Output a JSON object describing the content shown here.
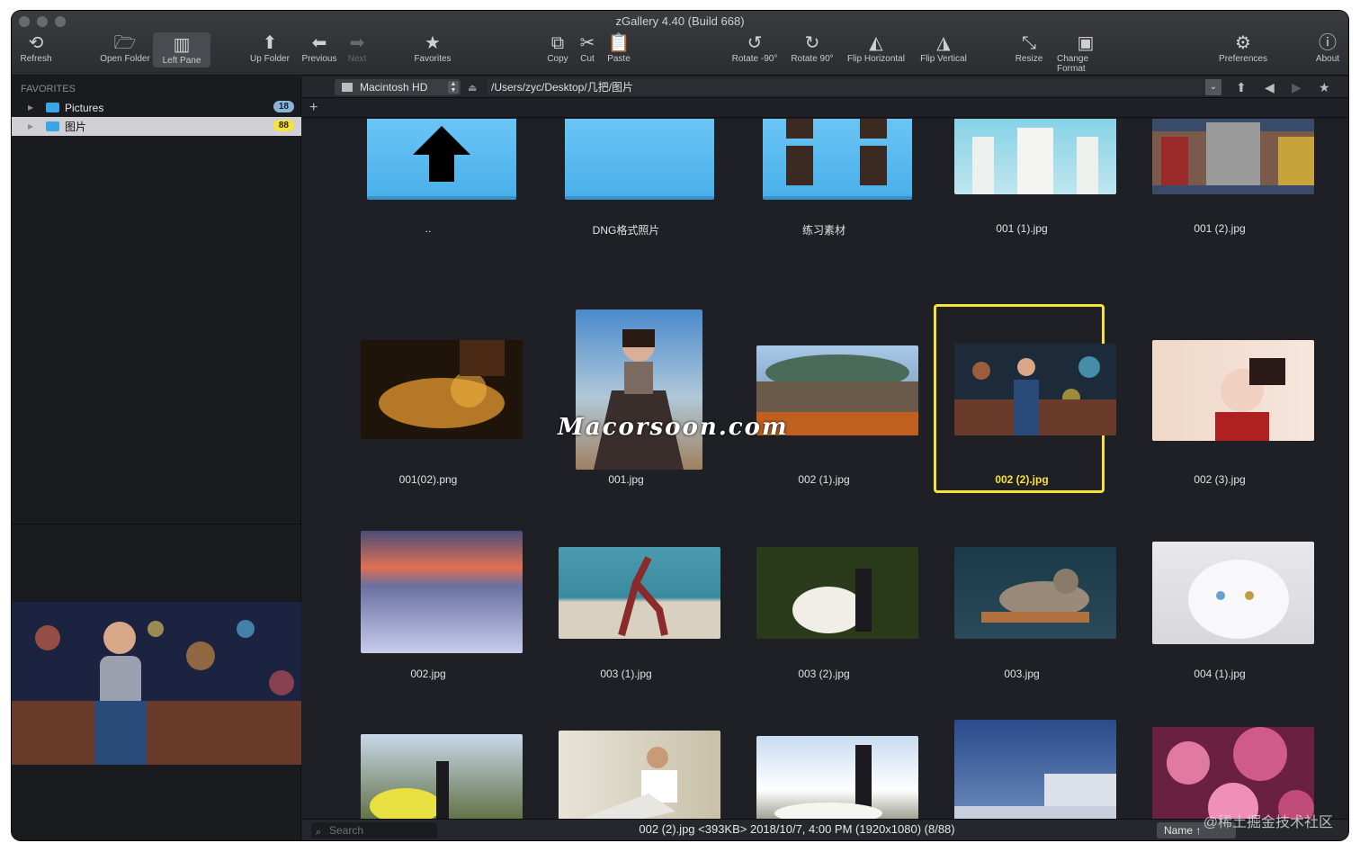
{
  "window": {
    "title": "zGallery 4.40 (Build 668)"
  },
  "toolbar": {
    "refresh": "Refresh",
    "open_folder": "Open Folder",
    "left_pane": "Left Pane",
    "up_folder": "Up Folder",
    "previous": "Previous",
    "next": "Next",
    "favorites": "Favorites",
    "copy": "Copy",
    "cut": "Cut",
    "paste": "Paste",
    "rotate_left": "Rotate -90°",
    "rotate_right": "Rotate 90°",
    "flip_h": "Flip Horizontal",
    "flip_v": "Flip Vertical",
    "resize": "Resize",
    "change_format": "Change Format",
    "preferences": "Preferences",
    "about": "About"
  },
  "sidebar": {
    "section": "FAVORITES",
    "items": [
      {
        "label": "Pictures",
        "count": "18"
      },
      {
        "label": "图片",
        "count": "88"
      }
    ]
  },
  "pathbar": {
    "volume": "Macintosh HD",
    "path": "/Users/zyc/Desktop/几把/图片"
  },
  "files": [
    {
      "name": ".."
    },
    {
      "name": "DNG格式照片"
    },
    {
      "name": "练习素材"
    },
    {
      "name": "001 (1).jpg"
    },
    {
      "name": "001 (2).jpg"
    },
    {
      "name": "001(02).png"
    },
    {
      "name": "001.jpg"
    },
    {
      "name": "002 (1).jpg"
    },
    {
      "name": "002 (2).jpg"
    },
    {
      "name": "002 (3).jpg"
    },
    {
      "name": "002.jpg"
    },
    {
      "name": "003 (1).jpg"
    },
    {
      "name": "003 (2).jpg"
    },
    {
      "name": "003.jpg"
    },
    {
      "name": "004 (1).jpg"
    }
  ],
  "status": {
    "search_placeholder": "Search",
    "info": "002 (2).jpg <393KB> 2018/10/7, 4:00 PM (1920x1080) (8/88)",
    "sort": "Name ↑"
  },
  "overlay": {
    "watermark": "Macorsoon.com",
    "corner": "@稀土掘金技术社区"
  },
  "colors": {
    "selection": "#f7e23a",
    "folder": "#4ab0ea",
    "background": "#1f2026"
  }
}
